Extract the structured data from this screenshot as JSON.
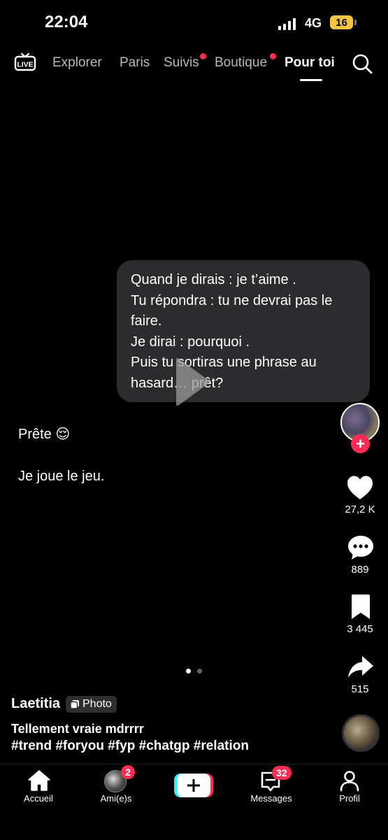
{
  "status": {
    "time": "22:04",
    "network": "4G",
    "battery": "16"
  },
  "nav": {
    "live": "LIVE",
    "tabs": [
      "Explorer",
      "Paris",
      "Suivis",
      "Boutique",
      "Pour toi"
    ]
  },
  "post": {
    "bubble_lines": [
      "Quand je dirais : je t’aime .",
      "Tu répondra : tu ne devrai pas le",
      "faire.",
      "Je dirai : pourquoi .",
      "Puis tu sortiras une phrase au",
      "hasard… prêt?"
    ],
    "caption_1": "Prête 😌",
    "caption_2": "Je joue le jeu.",
    "author": "Laetitia",
    "type_badge": "Photo",
    "description": "Tellement vraie mdrrrr",
    "hashtags": "#trend #foryou #fyp #chatgp #relation",
    "likes": "27,2 K",
    "comments": "889",
    "saves": "3 445",
    "shares": "515",
    "slides_total": 2,
    "slide_current": 1
  },
  "bottom_nav": {
    "home": "Accueil",
    "friends": "Ami(e)s",
    "friends_badge": "2",
    "messages": "Messages",
    "messages_badge": "32",
    "profile": "Profil"
  },
  "colors": {
    "accent": "#fe2c55",
    "bubble": "#2c2c2e",
    "battery": "#f5c542"
  }
}
